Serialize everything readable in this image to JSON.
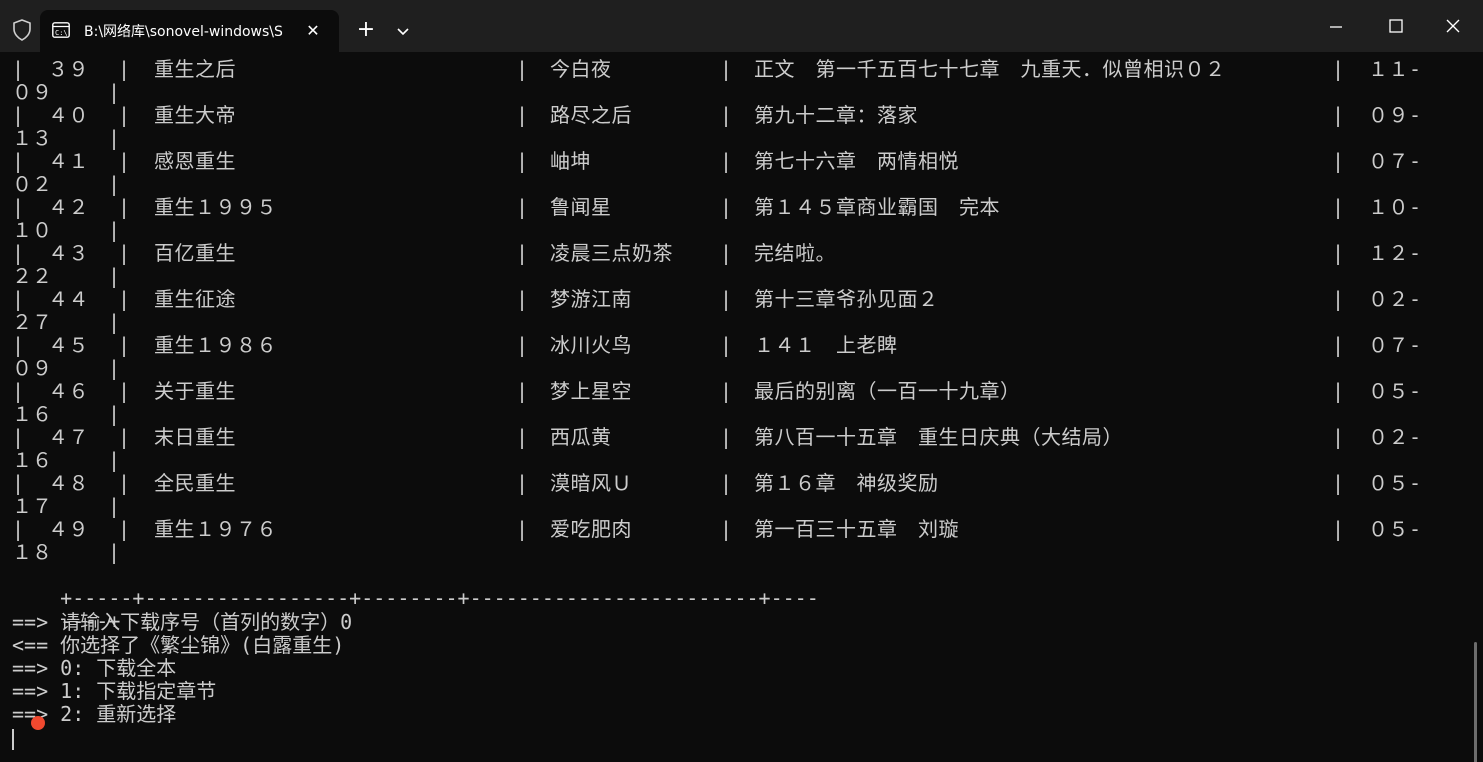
{
  "window": {
    "tab_title": "B:\\网络库\\sonovel-windows\\S",
    "tab_close_glyph": "✕",
    "new_tab_glyph": "+",
    "icons": {
      "shield": "shield-icon",
      "terminal": "terminal-icon",
      "dropdown": "chevron-down-icon",
      "minimize": "minimize-icon",
      "maximize": "maximize-icon",
      "close": "close-icon"
    }
  },
  "table": {
    "rows": [
      {
        "no": "３９",
        "title": "重生之后",
        "author": "今白夜",
        "chapter": "正文　第一千五百七十七章　九重天．似曾相识０２",
        "date_a": "１１-",
        "date_b": "０９"
      },
      {
        "no": "４０",
        "title": "重生大帝",
        "author": "路尽之后",
        "chapter": "第九十二章：落家",
        "date_a": "０９-",
        "date_b": "１３"
      },
      {
        "no": "４１",
        "title": "感恩重生",
        "author": "岫坤",
        "chapter": "第七十六章　两情相悦",
        "date_a": "０７-",
        "date_b": "０２"
      },
      {
        "no": "４２",
        "title": "重生１９９５",
        "author": "鲁闻星",
        "chapter": "第１４５章商业霸国　完本",
        "date_a": "１０-",
        "date_b": "１０"
      },
      {
        "no": "４３",
        "title": "百亿重生",
        "author": "凌晨三点奶茶",
        "chapter": "完结啦。",
        "date_a": "１２-",
        "date_b": "２２"
      },
      {
        "no": "４４",
        "title": "重生征途",
        "author": "梦游江南",
        "chapter": "第十三章爷孙见面２",
        "date_a": "０２-",
        "date_b": "２７"
      },
      {
        "no": "４５",
        "title": "重生１９８６",
        "author": "冰川火鸟",
        "chapter": "１４１　上老睥",
        "date_a": "０７-",
        "date_b": "０９"
      },
      {
        "no": "４６",
        "title": "关于重生",
        "author": "梦上星空",
        "chapter": "最后的别离（一百一十九章）",
        "date_a": "０５-",
        "date_b": "１６"
      },
      {
        "no": "４７",
        "title": "末日重生",
        "author": "西瓜黄",
        "chapter": "第八百一十五章　重生日庆典（大结局）",
        "date_a": "０２-",
        "date_b": "１６"
      },
      {
        "no": "４８",
        "title": "全民重生",
        "author": "漠暗风Ｕ",
        "chapter": "第１６章　神级奖励",
        "date_a": "０５-",
        "date_b": "１７"
      },
      {
        "no": "４９",
        "title": "重生１９７６",
        "author": "爱吃肥肉",
        "chapter": "第一百三十五章　刘璇",
        "date_a": "０５-",
        "date_b": "１８"
      }
    ],
    "border_line_1": "+-----+-----------------+--------+------------------------+----",
    "border_line_2": "----+"
  },
  "prompt_lines": [
    "==> 请输入下载序号（首列的数字）0",
    "<== 你选择了《繁尘锦》(白露重生)",
    "==> 0: 下载全本",
    "==> 1: 下载指定章节",
    "==> 2: 重新选择"
  ],
  "colors": {
    "background": "#0c0c0c",
    "titlebar": "#1f1f1f",
    "text": "#cccccc",
    "recording_dot": "#f0492f"
  }
}
